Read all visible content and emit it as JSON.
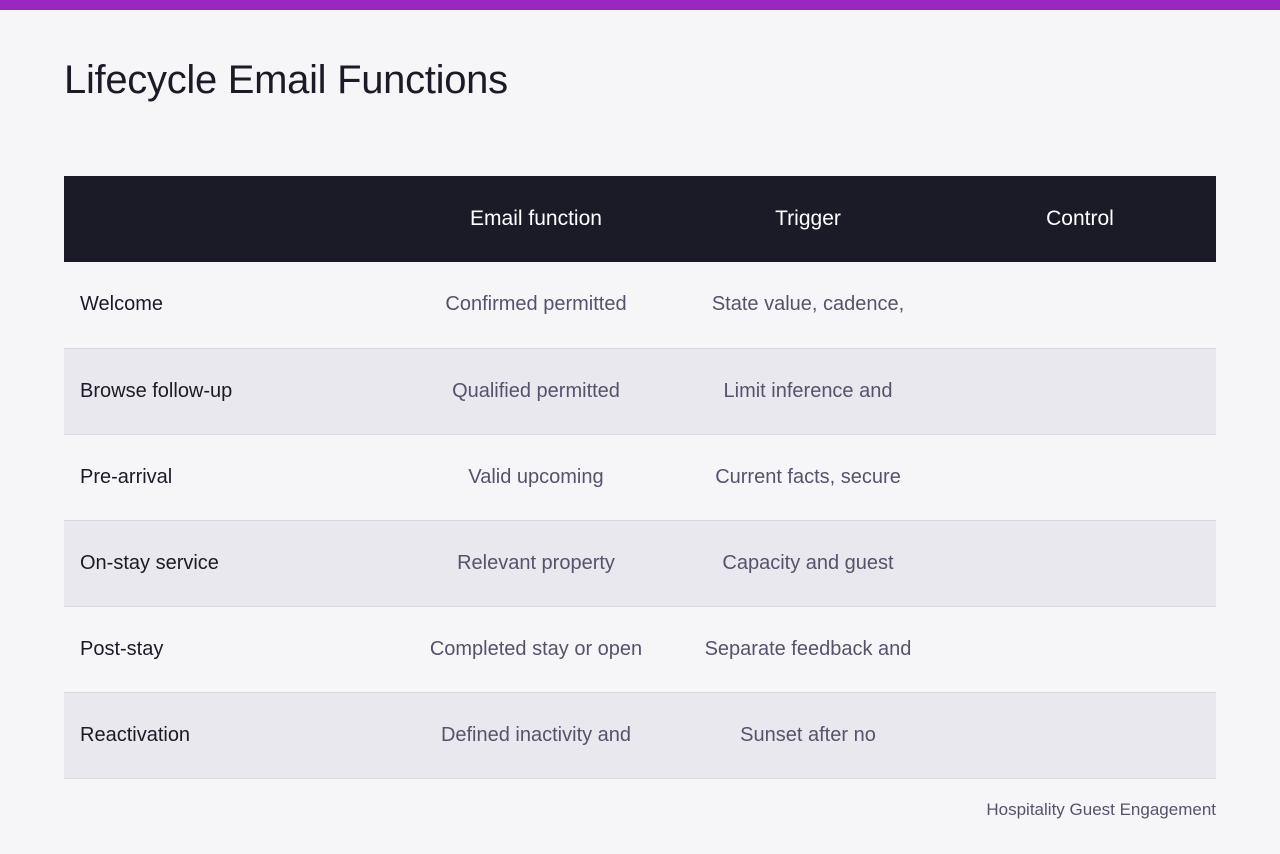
{
  "theme": {
    "accent": "#9a27c0",
    "header_bg": "#1b1a27",
    "page_bg": "#f6f6f9",
    "stripe_bg": "#e9e8ee"
  },
  "page": {
    "title": "Lifecycle Email Functions",
    "footer": "Hospitality Guest Engagement"
  },
  "table": {
    "headers": [
      "",
      "Email function",
      "Trigger",
      "Control"
    ],
    "rows": [
      {
        "label": "Welcome",
        "cells": [
          "Confirmed permitted",
          "State value, cadence,",
          ""
        ]
      },
      {
        "label": "Browse follow-up",
        "cells": [
          "Qualified permitted",
          "Limit inference and",
          ""
        ]
      },
      {
        "label": "Pre-arrival",
        "cells": [
          "Valid upcoming",
          "Current facts, secure",
          ""
        ]
      },
      {
        "label": "On-stay service",
        "cells": [
          "Relevant property",
          "Capacity and guest",
          ""
        ]
      },
      {
        "label": "Post-stay",
        "cells": [
          "Completed stay or open",
          "Separate feedback and",
          ""
        ]
      },
      {
        "label": "Reactivation",
        "cells": [
          "Defined inactivity and",
          "Sunset after no",
          ""
        ]
      }
    ]
  }
}
